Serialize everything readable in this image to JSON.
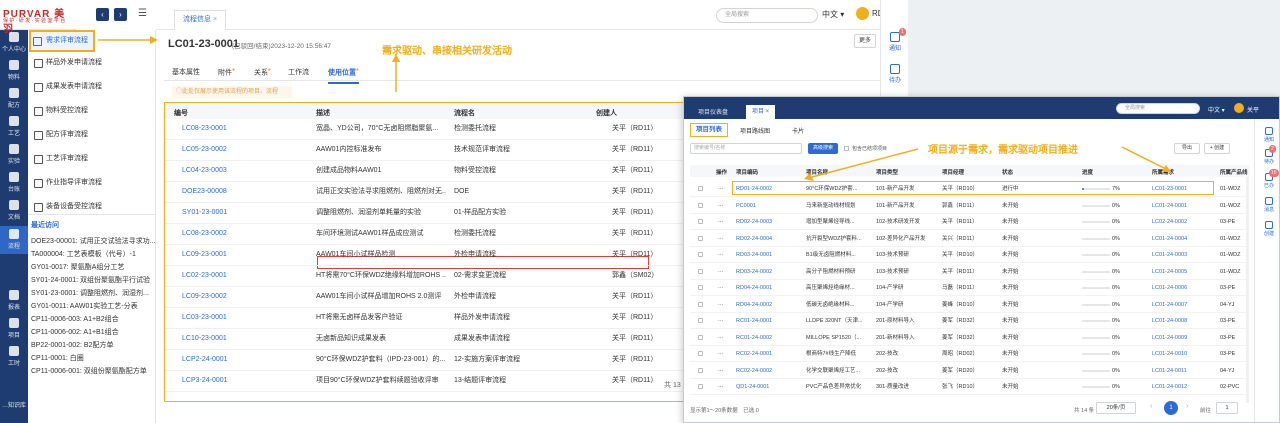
{
  "logo": {
    "title": "PURVAR 美 羽",
    "sub": "保 护 · 研 发 · 实 验 室 平 台"
  },
  "rail": [
    "个人中心",
    "物料",
    "配方",
    "工艺",
    "实验",
    "台账",
    "文档",
    "流程",
    "报表",
    "项目",
    "工时",
    "…知识库"
  ],
  "side": {
    "items": [
      "需求评审流程",
      "样品外发申请流程",
      "成果发表申请流程",
      "物料受控流程",
      "配方评审流程",
      "工艺评审流程",
      "作业指导评审流程",
      "装备设备受控流程"
    ],
    "recent_title": "最近访问",
    "recent": [
      "DOE23-00001: 试用正交试验法寻求功...",
      "TA000004: 工艺表模板（代号）-1",
      "GY01-0017: 聚氨酯A组分工艺",
      "SY01-24-0001: 双组份聚氨酯平行试验",
      "SY01-23-0001: 调整阻燃剂、润湿剂...",
      "GY01-0011: AAW01实验工艺-分表",
      "CP11-0006-003: A1+B2组合",
      "CP11-0006-002: A1+B1组合",
      "BP22-0001-002: B2配方单",
      "CP11-0001: 白圈",
      "CP11-0006-001: 双组份聚氨酯配方单"
    ]
  },
  "topbar": {
    "tab": "流程信息",
    "search": "全局搜索",
    "lang": "中文",
    "user": "RD11"
  },
  "main": {
    "title": "LC01-23-0001",
    "subtitle": "(已驳回/结束)2023-12-20 15:56:47",
    "more": "更多",
    "annotation": "需求驱动、串接相关研发活动",
    "tabs": [
      "基本属性",
      "附件",
      "关系",
      "工作流",
      "使用位置"
    ],
    "hint": "◯此处仅展示使用该流程的项目、流程",
    "columns": [
      "编号",
      "描述",
      "流程名",
      "创建人"
    ],
    "rows": [
      [
        "LC08-23-0001",
        "宽晶、YD公司，70°C无卤阻燃脂聚氨...",
        "检测委托流程",
        "关平（RD11）"
      ],
      [
        "LC05-23-0002",
        "AAW01内控标准发布",
        "技术规范评审流程",
        "关平（RD11）"
      ],
      [
        "LC04-23-0003",
        "创建成品物料AAW01",
        "物料受控流程",
        "关平（RD11）"
      ],
      [
        "DOE23-00008",
        "试用正交实验法寻求阻燃剂、阻燃剂对无...",
        "DOE",
        "关平（RD11）"
      ],
      [
        "SY01-23-0001",
        "调整阻燃剂、润湿剂单耗量的实验",
        "01-样品配方实验",
        "关平（RD11）"
      ],
      [
        "LC08-23-0002",
        "车间环境测试AAW01样品成应测试",
        "检测委托流程",
        "关平（RD11）"
      ],
      [
        "LC09-23-0001",
        "AAW01车间小试样品检测",
        "外检申请流程",
        "关平（RD11）"
      ],
      [
        "LC02-23-0001",
        "HT将需70°C环保WDZ绝缘料增加ROHS ...",
        "02-需求变更流程",
        "郭鑫（SM02）"
      ],
      [
        "LC09-23-0002",
        "AAW01车间小试样品增加ROHS 2.0测评",
        "外检申请流程",
        "关平（RD11）"
      ],
      [
        "LC03-23-0001",
        "HT将需无卤样品发客户验证",
        "样品外发申请流程",
        "关平（RD11）"
      ],
      [
        "LC10-23-0001",
        "无卤新品知识成果发表",
        "成果发表申请流程",
        "关平（RD11）"
      ],
      [
        "LCP2-24-0001",
        "90°C环保WDZ护套料（IPD-23-001）的...",
        "12-实施方案评审流程",
        "关平（RD11）"
      ],
      [
        "LCP3-24-0001",
        "项目90°C环保WDZ护套料续题验收评审",
        "13-结题评审流程",
        "关平（RD11）"
      ]
    ],
    "total": "共 13"
  },
  "rnav": [
    "通知",
    "待办",
    "已办",
    "消息",
    "创建"
  ],
  "shot": {
    "tabs": [
      "项目仪表盘",
      "项目"
    ],
    "search": "全局搜索",
    "lang": "中文",
    "user": "关平",
    "subtabs": [
      "项目列表",
      "项目路线图",
      "卡片"
    ],
    "annotation": "项目源于需求，需求驱动项目推进",
    "search_ph": "搜索编号/名称",
    "adv": "高级搜索",
    "include": "包含已结项项目",
    "export": "导出",
    "create": "+ 创建",
    "columns": [
      "操作",
      "项目编码",
      "项目名称",
      "项目类型",
      "项目经理",
      "状态",
      "进度",
      "所属需求",
      "所属产品线"
    ],
    "rows": [
      [
        "RD01-24-0002",
        "90°C环保WDZ护套...",
        "101-新产品开发",
        "关平（RD10）",
        "进行中",
        "7%",
        "LC01-23-0001",
        "01-WDZ"
      ],
      [
        "PC0001",
        "马来新驱动线材规划",
        "101-新产品开发",
        "郭鑫（RD11）",
        "未开始",
        "0%",
        "LC01-24-0001",
        "01-WDZ"
      ],
      [
        "RD02-24-0003",
        "增加型聚烯烃导线...",
        "102-技术研发开发",
        "关平（RD11）",
        "未开始",
        "0%",
        "LC02-24-0002",
        "03-PE"
      ],
      [
        "RD02-24-0004",
        "抗开裂型WDZ护套料...",
        "102-差异化产品开发",
        "关兴（RD11）",
        "未开始",
        "0%",
        "LC01-24-0004",
        "01-WDZ"
      ],
      [
        "RD03-24-0001",
        "B1级无卤阻燃材料...",
        "103-技术预研",
        "关平（RD10）",
        "未开始",
        "0%",
        "LC01-24-0003",
        "01-WDZ"
      ],
      [
        "RD03-24-0002",
        "高分子阻燃材料预研",
        "103-技术预研",
        "关平（RD11）",
        "未开始",
        "0%",
        "LC01-24-0005",
        "01-WDZ"
      ],
      [
        "RD04-24-0001",
        "高压聚烯烃绝缘材...",
        "104-产学研",
        "马磊（RD11）",
        "未开始",
        "0%",
        "LC01-24-0006",
        "03-PE"
      ],
      [
        "RD04-24-0002",
        "低碳无卤绝缘材料...",
        "104-产学研",
        "姜峰（RD10）",
        "未开始",
        "0%",
        "LC01-24-0007",
        "04-YJ"
      ],
      [
        "RC01-24-0001",
        "LLDPE 320NT（天津...",
        "201-原材料导入",
        "姜军（RD32）",
        "未开始",
        "0%",
        "LC01-24-0008",
        "03-PE"
      ],
      [
        "RC01-24-0002",
        "MILLOPE SP1520（...",
        "201-新材料导入",
        "姜军（RD32）",
        "未开始",
        "0%",
        "LC01-24-0009",
        "03-PE"
      ],
      [
        "RC02-24-0001",
        "根商特7#线生产降低",
        "202-技改",
        "周昭（RD02）",
        "未开始",
        "0%",
        "LC01-24-0010",
        "03-PE"
      ],
      [
        "RC02-24-0002",
        "化学交联聚烯烃工艺...",
        "202-技改",
        "姜军（RD20）",
        "未开始",
        "0%",
        "LC01-24-0011",
        "04-YJ"
      ],
      [
        "QD1-24-0001",
        "PVC产品色差异常优化",
        "301-质量改进",
        "张飞（RD10）",
        "未开始",
        "0%",
        "LC01-24-0012",
        "02-PVC"
      ]
    ],
    "footer_left": "显示第1～20条数据　已选 0",
    "total": "共 14 条",
    "page_size": "20条/页",
    "page": "1",
    "goto": "前往",
    "goto_val": "1"
  },
  "colors": {
    "brand": "#1e3c70",
    "link": "#2b6bd6",
    "annotation": "#f3ae1c",
    "highlight": "#e53935"
  }
}
